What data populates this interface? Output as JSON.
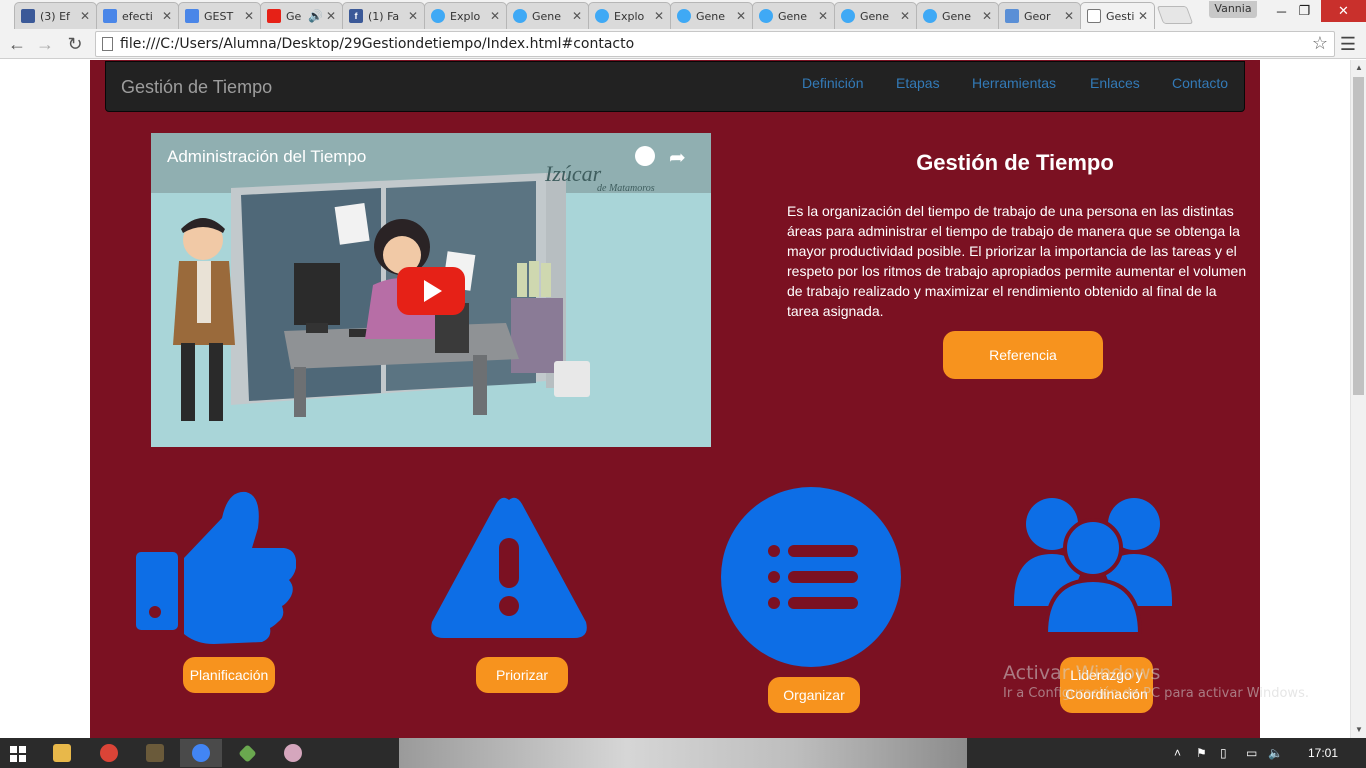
{
  "browser": {
    "tabs": [
      {
        "title": "(3) Ef",
        "favicon_color": "#3b5998"
      },
      {
        "title": "efecti",
        "favicon_color": "#4a86e8"
      },
      {
        "title": "GEST",
        "favicon_color": "#4a86e8"
      },
      {
        "title": "Ge",
        "favicon_color": "#e62117"
      },
      {
        "title": "(1) Fa",
        "favicon_color": "#3b5998"
      },
      {
        "title": "Explo",
        "favicon_color": "#3fa9f5"
      },
      {
        "title": "Gene",
        "favicon_color": "#3fa9f5"
      },
      {
        "title": "Explo",
        "favicon_color": "#3fa9f5"
      },
      {
        "title": "Gene",
        "favicon_color": "#3fa9f5"
      },
      {
        "title": "Gene",
        "favicon_color": "#3fa9f5"
      },
      {
        "title": "Gene",
        "favicon_color": "#3fa9f5"
      },
      {
        "title": "Gene",
        "favicon_color": "#3fa9f5"
      },
      {
        "title": "Geor",
        "favicon_color": "#5a8fd6"
      },
      {
        "title": "Gesti",
        "favicon_color": "#ffffff"
      }
    ],
    "user": "Vannia",
    "url": "file:///C:/Users/Alumna/Desktop/29Gestiondetiempo/Index.html#contacto"
  },
  "navbar": {
    "brand": "Gestión de Tiempo",
    "links": [
      "Definición",
      "Etapas",
      "Herramientas",
      "Enlaces",
      "Contacto"
    ]
  },
  "video": {
    "title": "Administración del Tiempo",
    "watermark": "Izúcar",
    "watermark_sub": "de Matamoros"
  },
  "intro": {
    "title": "Gestión de Tiempo",
    "text": "Es la organización del tiempo de trabajo de una persona en las distintas áreas para administrar el tiempo de trabajo de manera que se obtenga la mayor productividad posible. El priorizar la importancia de las tareas y el respeto por los ritmos de trabajo apropiados permite aumentar el volumen de trabajo realizado y maximizar el rendimiento obtenido al final de la tarea asignada.",
    "button": "Referencia"
  },
  "features": [
    {
      "icon": "thumbs-up-icon",
      "label": "Planificación"
    },
    {
      "icon": "warning-icon",
      "label": "Priorizar"
    },
    {
      "icon": "list-icon",
      "label": "Organizar"
    },
    {
      "icon": "users-icon",
      "label": "Liderazgo y Coordinación"
    }
  ],
  "os": {
    "activation_title": "Activar Windows",
    "activation_sub": "Ir a Configuración de PC para activar Windows.",
    "clock": "17:01"
  },
  "colors": {
    "page_bg": "#7b1122",
    "navbar_bg": "#222222",
    "link": "#337ab7",
    "accent_orange": "#f7931e",
    "icon_blue": "#0d6ee6"
  }
}
